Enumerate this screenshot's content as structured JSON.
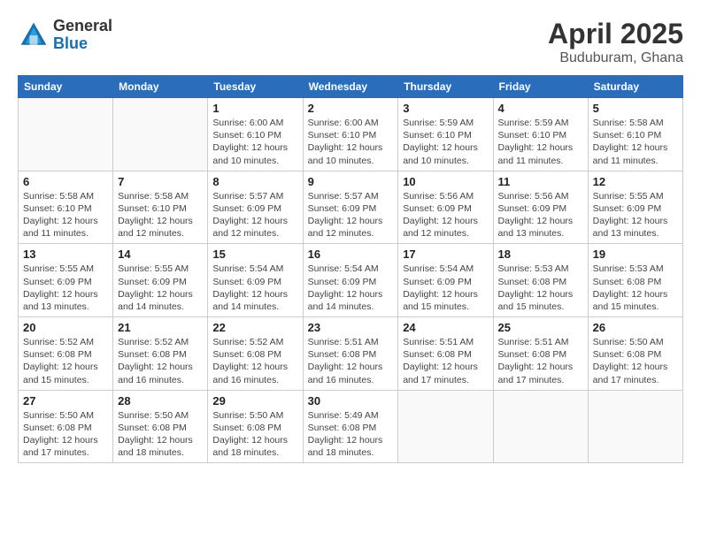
{
  "header": {
    "logo_general": "General",
    "logo_blue": "Blue",
    "title": "April 2025",
    "location": "Buduburam, Ghana"
  },
  "weekdays": [
    "Sunday",
    "Monday",
    "Tuesday",
    "Wednesday",
    "Thursday",
    "Friday",
    "Saturday"
  ],
  "weeks": [
    [
      {
        "day": "",
        "info": ""
      },
      {
        "day": "",
        "info": ""
      },
      {
        "day": "1",
        "info": "Sunrise: 6:00 AM\nSunset: 6:10 PM\nDaylight: 12 hours and 10 minutes."
      },
      {
        "day": "2",
        "info": "Sunrise: 6:00 AM\nSunset: 6:10 PM\nDaylight: 12 hours and 10 minutes."
      },
      {
        "day": "3",
        "info": "Sunrise: 5:59 AM\nSunset: 6:10 PM\nDaylight: 12 hours and 10 minutes."
      },
      {
        "day": "4",
        "info": "Sunrise: 5:59 AM\nSunset: 6:10 PM\nDaylight: 12 hours and 11 minutes."
      },
      {
        "day": "5",
        "info": "Sunrise: 5:58 AM\nSunset: 6:10 PM\nDaylight: 12 hours and 11 minutes."
      }
    ],
    [
      {
        "day": "6",
        "info": "Sunrise: 5:58 AM\nSunset: 6:10 PM\nDaylight: 12 hours and 11 minutes."
      },
      {
        "day": "7",
        "info": "Sunrise: 5:58 AM\nSunset: 6:10 PM\nDaylight: 12 hours and 12 minutes."
      },
      {
        "day": "8",
        "info": "Sunrise: 5:57 AM\nSunset: 6:09 PM\nDaylight: 12 hours and 12 minutes."
      },
      {
        "day": "9",
        "info": "Sunrise: 5:57 AM\nSunset: 6:09 PM\nDaylight: 12 hours and 12 minutes."
      },
      {
        "day": "10",
        "info": "Sunrise: 5:56 AM\nSunset: 6:09 PM\nDaylight: 12 hours and 12 minutes."
      },
      {
        "day": "11",
        "info": "Sunrise: 5:56 AM\nSunset: 6:09 PM\nDaylight: 12 hours and 13 minutes."
      },
      {
        "day": "12",
        "info": "Sunrise: 5:55 AM\nSunset: 6:09 PM\nDaylight: 12 hours and 13 minutes."
      }
    ],
    [
      {
        "day": "13",
        "info": "Sunrise: 5:55 AM\nSunset: 6:09 PM\nDaylight: 12 hours and 13 minutes."
      },
      {
        "day": "14",
        "info": "Sunrise: 5:55 AM\nSunset: 6:09 PM\nDaylight: 12 hours and 14 minutes."
      },
      {
        "day": "15",
        "info": "Sunrise: 5:54 AM\nSunset: 6:09 PM\nDaylight: 12 hours and 14 minutes."
      },
      {
        "day": "16",
        "info": "Sunrise: 5:54 AM\nSunset: 6:09 PM\nDaylight: 12 hours and 14 minutes."
      },
      {
        "day": "17",
        "info": "Sunrise: 5:54 AM\nSunset: 6:09 PM\nDaylight: 12 hours and 15 minutes."
      },
      {
        "day": "18",
        "info": "Sunrise: 5:53 AM\nSunset: 6:08 PM\nDaylight: 12 hours and 15 minutes."
      },
      {
        "day": "19",
        "info": "Sunrise: 5:53 AM\nSunset: 6:08 PM\nDaylight: 12 hours and 15 minutes."
      }
    ],
    [
      {
        "day": "20",
        "info": "Sunrise: 5:52 AM\nSunset: 6:08 PM\nDaylight: 12 hours and 15 minutes."
      },
      {
        "day": "21",
        "info": "Sunrise: 5:52 AM\nSunset: 6:08 PM\nDaylight: 12 hours and 16 minutes."
      },
      {
        "day": "22",
        "info": "Sunrise: 5:52 AM\nSunset: 6:08 PM\nDaylight: 12 hours and 16 minutes."
      },
      {
        "day": "23",
        "info": "Sunrise: 5:51 AM\nSunset: 6:08 PM\nDaylight: 12 hours and 16 minutes."
      },
      {
        "day": "24",
        "info": "Sunrise: 5:51 AM\nSunset: 6:08 PM\nDaylight: 12 hours and 17 minutes."
      },
      {
        "day": "25",
        "info": "Sunrise: 5:51 AM\nSunset: 6:08 PM\nDaylight: 12 hours and 17 minutes."
      },
      {
        "day": "26",
        "info": "Sunrise: 5:50 AM\nSunset: 6:08 PM\nDaylight: 12 hours and 17 minutes."
      }
    ],
    [
      {
        "day": "27",
        "info": "Sunrise: 5:50 AM\nSunset: 6:08 PM\nDaylight: 12 hours and 17 minutes."
      },
      {
        "day": "28",
        "info": "Sunrise: 5:50 AM\nSunset: 6:08 PM\nDaylight: 12 hours and 18 minutes."
      },
      {
        "day": "29",
        "info": "Sunrise: 5:50 AM\nSunset: 6:08 PM\nDaylight: 12 hours and 18 minutes."
      },
      {
        "day": "30",
        "info": "Sunrise: 5:49 AM\nSunset: 6:08 PM\nDaylight: 12 hours and 18 minutes."
      },
      {
        "day": "",
        "info": ""
      },
      {
        "day": "",
        "info": ""
      },
      {
        "day": "",
        "info": ""
      }
    ]
  ]
}
